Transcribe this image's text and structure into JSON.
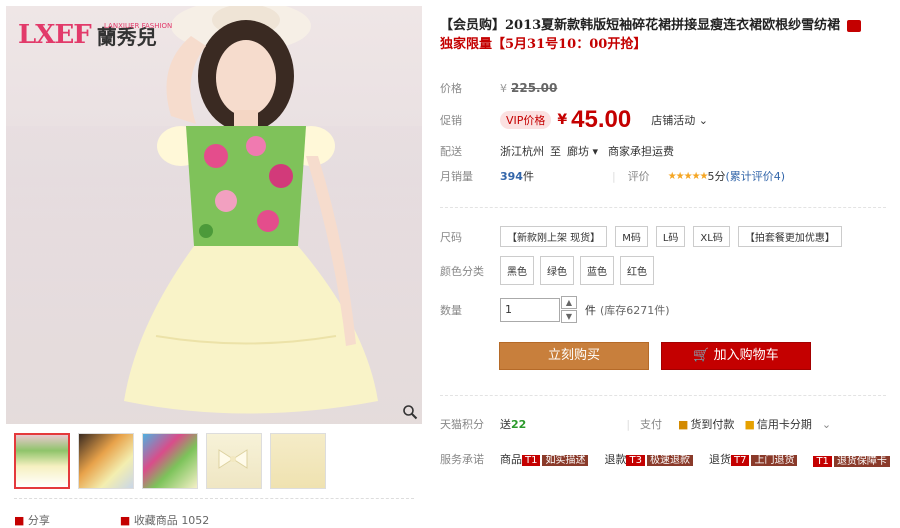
{
  "brand": {
    "mark": "LXEF",
    "name": "蘭秀兒",
    "sub": "LANXIUER FASHION"
  },
  "product": {
    "title": "【会员购】2013夏新款韩版短袖碎花裙拼接显瘦连衣裙欧根纱雪纺裙",
    "subtitle": "独家限量【5月31号10：00开抢】"
  },
  "price": {
    "label": "价格",
    "yen": "¥",
    "original": "225.00",
    "promo_label": "促销",
    "vip_tag": "VIP价格",
    "promo_yen": "¥",
    "promo_price": "45.00",
    "store_activity": "店铺活动"
  },
  "shipping": {
    "label": "配送",
    "from": "浙江杭州",
    "to_word": "至",
    "dest": "廊坊",
    "dest_arrow": "▾",
    "note": "商家承担运费"
  },
  "sales": {
    "label": "月销量",
    "count": "394",
    "unit": "件",
    "rating_label": "评价",
    "stars": "★★★★★",
    "score": "5分",
    "reviews": "(累计评价4)"
  },
  "size": {
    "label": "尺码",
    "options": [
      "【新款刚上架 现货】",
      "M码",
      "L码",
      "XL码",
      "【拍套餐更加优惠】"
    ]
  },
  "color": {
    "label": "颜色分类",
    "options": [
      "黑色",
      "绿色",
      "蓝色",
      "红色"
    ]
  },
  "quantity": {
    "label": "数量",
    "value": "1",
    "unit": "件",
    "stock": "(库存6271件)"
  },
  "actions": {
    "buy": "立刻购买",
    "cart": "加入购物车"
  },
  "points": {
    "label": "天猫积分",
    "prefix": "送",
    "value": "22"
  },
  "payment": {
    "label": "支付",
    "cod": "货到付款",
    "credit": "信用卡分期"
  },
  "service": {
    "label": "服务承诺",
    "items": [
      {
        "prefix": "商品",
        "badge": "T1",
        "text": "如实描述"
      },
      {
        "prefix": "退款",
        "badge": "T3",
        "text": "极速退款"
      },
      {
        "prefix": "退货",
        "badge": "T7",
        "text": "上门退货"
      },
      {
        "prefix": "",
        "badge": "T1",
        "text": "退货保障卡"
      }
    ]
  },
  "footer": {
    "share": "分享",
    "fav": "收藏商品",
    "fav_count": "1052"
  },
  "colors": {
    "accent": "#c40000",
    "buy": "#c87f3c"
  }
}
